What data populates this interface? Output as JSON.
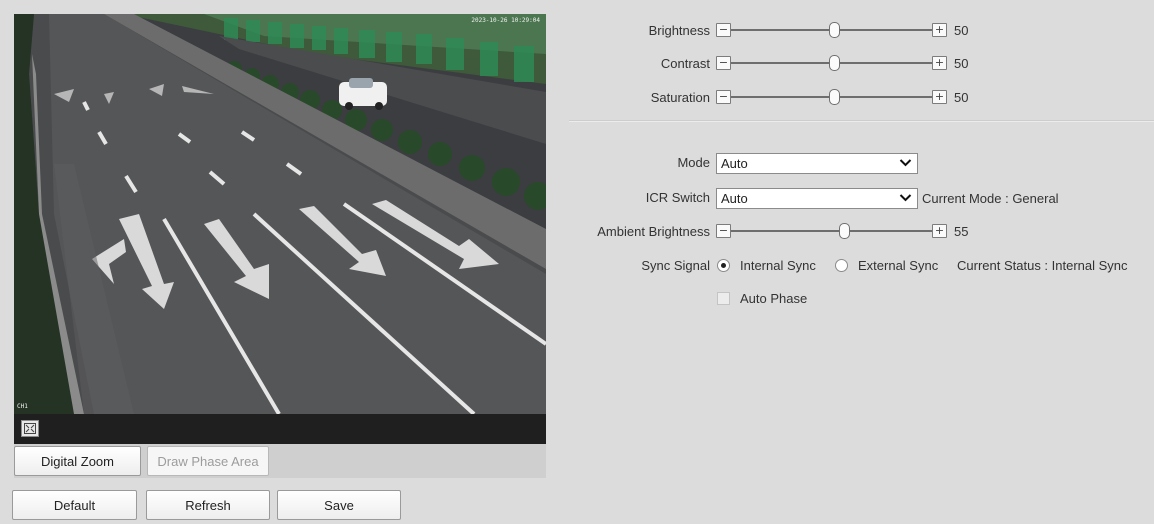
{
  "video": {
    "osd_time": "2023-10-26 10:29:04",
    "osd_channel": "CH1",
    "buttons": {
      "digital_zoom": "Digital Zoom",
      "draw_phase_area": "Draw Phase Area"
    },
    "fullscreen_icon": "fullscreen-icon"
  },
  "image": {
    "brightness": {
      "label": "Brightness",
      "value": "50",
      "level": 0.5
    },
    "contrast": {
      "label": "Contrast",
      "value": "50",
      "level": 0.5
    },
    "saturation": {
      "label": "Saturation",
      "value": "50",
      "level": 0.5
    },
    "minus_glyph": "−",
    "plus_glyph": "+"
  },
  "sync": {
    "mode_label": "Mode",
    "mode_value": "Auto",
    "icr_label": "ICR Switch",
    "icr_value": "Auto",
    "current_mode": "Current Mode : General",
    "ambient_label": "Ambient Brightness",
    "ambient_value": "55",
    "ambient_level": 0.55,
    "sync_signal_label": "Sync Signal",
    "internal_sync": "Internal Sync",
    "external_sync": "External Sync",
    "current_status": "Current Status : Internal Sync",
    "auto_phase": "Auto Phase"
  },
  "footer": {
    "default": "Default",
    "refresh": "Refresh",
    "save": "Save"
  },
  "colors": {
    "background": "#dcdcdc",
    "video_bar": "#1f1f1f"
  }
}
